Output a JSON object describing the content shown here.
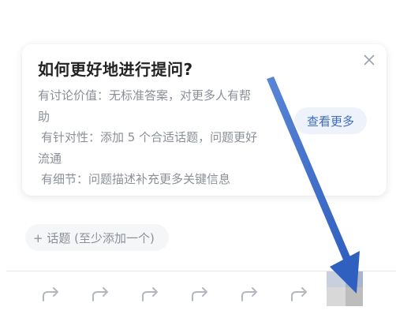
{
  "tip": {
    "title": "如何更好地进行提问?",
    "lines": [
      "有讨论价值：无标准答案，对更多人有帮",
      "助",
      "有针对性：添加 5 个合适话题，问题更好",
      "流通",
      "有细节：问题描述补充更多关键信息"
    ],
    "see_more_label": "查看更多",
    "close_icon": "close-icon"
  },
  "topic": {
    "label": "+ 话题 (至少添加一个)"
  },
  "share_bar": {
    "icon": "share-arrow-icon",
    "count": 6
  },
  "colors": {
    "title": "#222222",
    "body_text": "#8a8f99",
    "accent": "#3f6cc4",
    "accent_bg": "#eef3fb",
    "chip_bg": "#f5f6f7",
    "annotation_arrow": "#3b6cc9"
  }
}
